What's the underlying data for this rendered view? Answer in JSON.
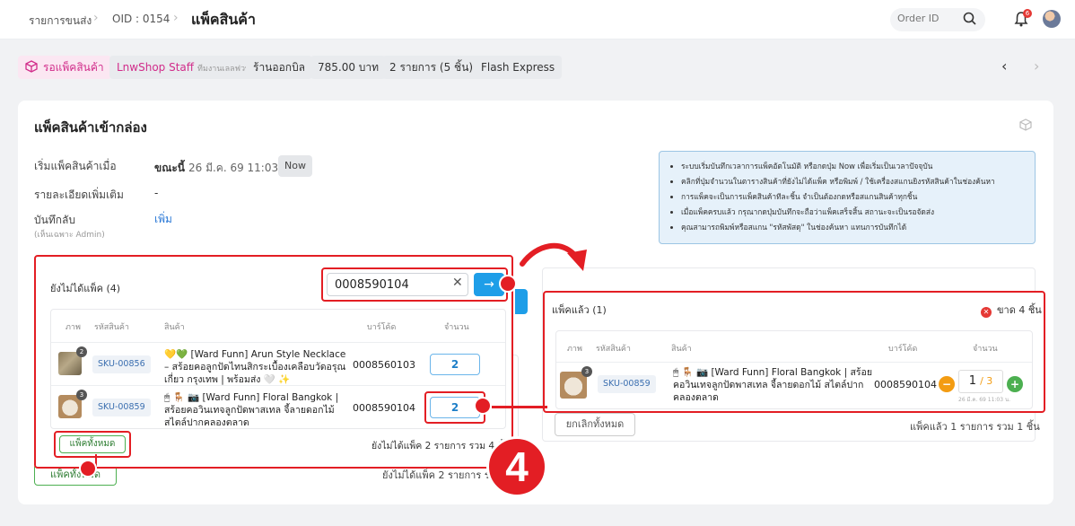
{
  "breadcrumb": {
    "item1": "รายการขนส่ง",
    "item2": "OID : 0154",
    "current": "แพ็คสินค้า"
  },
  "topbar": {
    "search_placeholder": "Order ID",
    "notification_count": "6"
  },
  "chips": {
    "status": "รอแพ็คสินค้า",
    "staff": "LnwShop Staff",
    "staff_sub": "ทีมงานเลลฟวท์",
    "shop_bill": "ร้านออกบิล",
    "amount": "785.00 บาท",
    "items": "2 รายการ (5 ชิ้น)",
    "shipping": "Flash Express"
  },
  "card": {
    "title": "แพ็คสินค้าเข้ากล่อง",
    "start_label": "เริ่มแพ็คสินค้าเมื่อ",
    "start_now": "ขณะนี้",
    "start_date": "26 มี.ค. 69 11:03 น.",
    "now_button": "Now",
    "details_label": "รายละเอียดเพิ่มเติม",
    "details_value": "-",
    "note_label": "บันทึกลับ",
    "note_sub": "(เห็นเฉพาะ Admin)",
    "note_add": "เพิ่ม"
  },
  "info": [
    "ระบบเริ่มบันทึกเวลาการแพ็คอัตโนมัติ หรือกดปุ่ม Now เพื่อเริ่มเป็นเวลาปัจจุบัน",
    "คลิกที่ปุ่มจำนวนในตารางสินค้าที่ยังไม่ได้แพ็ค หรือพิมพ์ / ใช้เครื่องสแกนยิงรหัสสินค้าในช่องค้นหา",
    "การแพ็คจะเป็นการแพ็คสินค้าทีละชิ้น จำเป็นต้องกดหรือสแกนสินค้าทุกชิ้น",
    "เมื่อแพ็คครบแล้ว กรุณากดปุ่มบันทึกจะถือว่าแพ็คเสร็จสิ้น สถานะจะเป็นรอจัดส่ง",
    "คุณสามารถพิมพ์หรือสแกน \"รหัสพัสดุ\" ในช่องค้นหา แทนการบันทึกได้"
  ],
  "unpacked": {
    "title": "ยังไม่ได้แพ็ค (4)",
    "search_value": "0008590104",
    "headers": {
      "image": "ภาพ",
      "sku": "รหัสสินค้า",
      "product": "สินค้า",
      "barcode": "บาร์โค้ด",
      "qty": "จำนวน"
    },
    "rows": [
      {
        "badge": "2",
        "sku": "SKU-00856",
        "name": "💛💚 [Ward Funn] Arun Style Necklace – สร้อยคอลูกปัดไทนสิกระเบื้องเคลือบวัดอรุณ เกี่ยว กรุงเทพ | พร้อมส่ง 🤍 ✨",
        "barcode": "0008560103",
        "qty": "2"
      },
      {
        "badge": "3",
        "sku": "SKU-00859",
        "name": "🖱 🪑 📷 [Ward Funn] Floral Bangkok | สร้อยคอวินเทจลูกปัดพาสเทล จี้ลายดอกไม้ สไตล์ปากคลองตลาด",
        "barcode": "0008590104",
        "qty": "2"
      }
    ],
    "pack_all": "แพ็คทั้งหมด",
    "summary": "ยังไม่ได้แพ็ค 2 รายการ รวม 4 ชิ้น"
  },
  "packed": {
    "title": "แพ็คแล้ว (1)",
    "shortage": "ขาด 4 ชิ้น",
    "headers": {
      "image": "ภาพ",
      "sku": "รหัสสินค้า",
      "product": "สินค้า",
      "barcode": "บาร์โค้ด",
      "qty": "จำนวน"
    },
    "row": {
      "badge": "3",
      "sku": "SKU-00859",
      "name": "🖱 🪑 📷 [Ward Funn] Floral Bangkok | สร้อยคอวินเทจลูกปัดพาสเทล จี้ลายดอกไม้ สไตล์ปากคลองตลาด",
      "barcode": "0008590104",
      "qty": "1",
      "total": "/ 3",
      "time": "26 มี.ค. 69 11:03 น."
    },
    "cancel_all": "ยกเลิกทั้งหมด",
    "summary": "แพ็คแล้ว 1 รายการ รวม 1 ชิ้น"
  },
  "under": {
    "pack_all": "แพ็คทั้งหมด",
    "summary": "ยังไม่ได้แพ็ค 2 รายการ รวม 4 ชิ้น"
  },
  "annotation": {
    "step": "4"
  },
  "colors": {
    "accent": "#1e9ee8",
    "highlight": "#e31e24",
    "brand_pink": "#d12c8a",
    "success": "#4caf50",
    "warning": "#f39c12"
  }
}
